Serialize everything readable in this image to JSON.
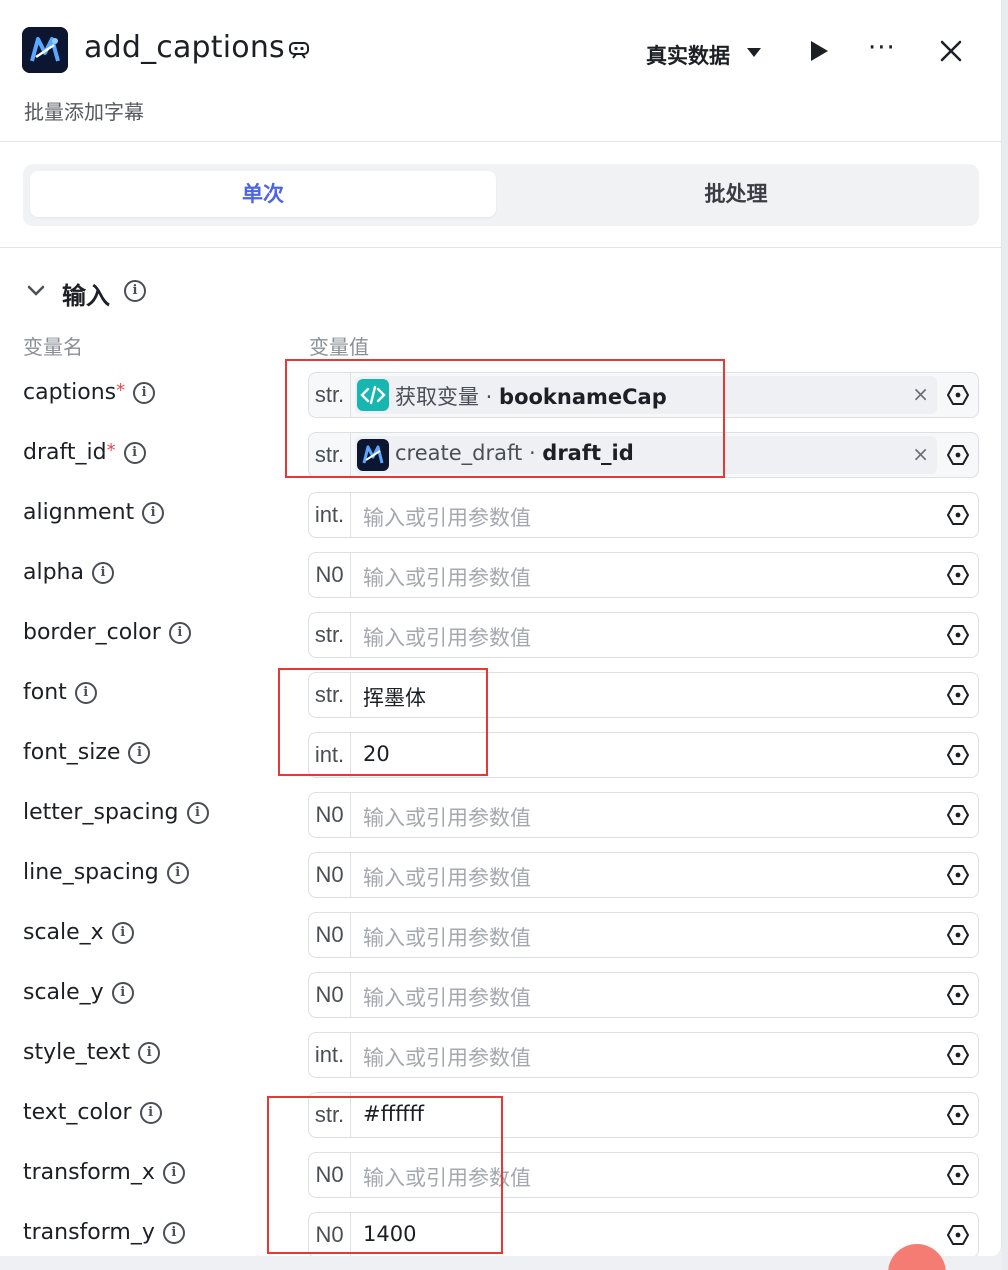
{
  "header": {
    "title": "add_captions",
    "subtitle": "批量添加字幕",
    "mode": "真实数据",
    "more": "···"
  },
  "tabs": [
    {
      "label": "单次",
      "active": true
    },
    {
      "label": "批处理",
      "active": false
    }
  ],
  "section": {
    "title": "输入",
    "col_name": "变量名",
    "col_value": "变量值"
  },
  "placeholder": "输入或引用参数值",
  "params": [
    {
      "name": "captions",
      "required": true,
      "type": "str.",
      "ref": {
        "source": "获取变量",
        "sep": " · ",
        "var": "bookname​Cap",
        "icon": "code-icon"
      }
    },
    {
      "name": "draft_id",
      "required": true,
      "type": "str.",
      "ref": {
        "source": "create_draft",
        "sep": " · ",
        "var": "draft_id",
        "icon": "app-logo-icon"
      }
    },
    {
      "name": "alignment",
      "type": "int.",
      "value": ""
    },
    {
      "name": "alpha",
      "type": "N0",
      "value": ""
    },
    {
      "name": "border_color",
      "type": "str.",
      "value": ""
    },
    {
      "name": "font",
      "type": "str.",
      "value": "挥墨体"
    },
    {
      "name": "font_size",
      "type": "int.",
      "value": "20"
    },
    {
      "name": "letter_spacing",
      "type": "N0",
      "value": ""
    },
    {
      "name": "line_spacing",
      "type": "N0",
      "value": ""
    },
    {
      "name": "scale_x",
      "type": "N0",
      "value": ""
    },
    {
      "name": "scale_y",
      "type": "N0",
      "value": ""
    },
    {
      "name": "style_text",
      "type": "int.",
      "value": ""
    },
    {
      "name": "text_color",
      "type": "str.",
      "value": "#ffffff"
    },
    {
      "name": "transform_x",
      "type": "N0",
      "value": ""
    },
    {
      "name": "transform_y",
      "type": "N0",
      "value": "1400"
    }
  ],
  "colors": {
    "accent": "#4b64e8",
    "required": "#e5484d",
    "annotation": "#e53935"
  }
}
